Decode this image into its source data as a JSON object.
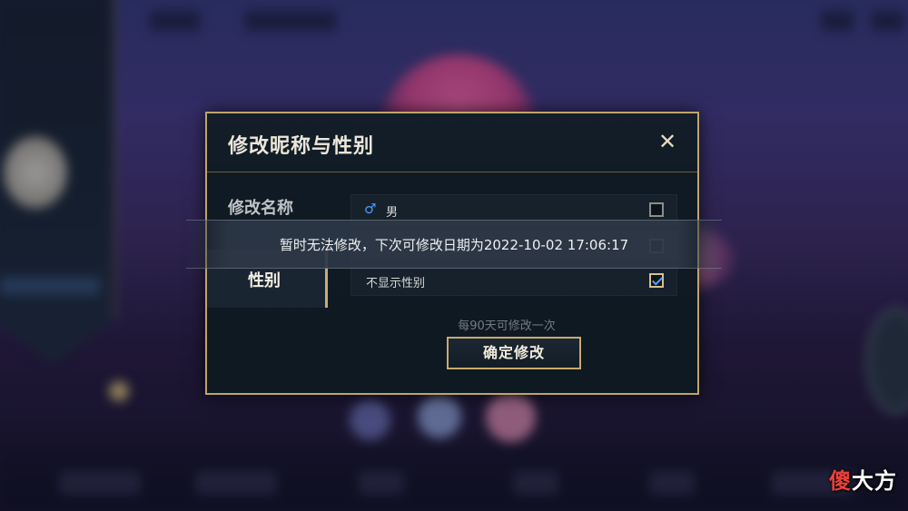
{
  "dialog": {
    "title": "修改昵称与性别",
    "close_icon": "close-icon",
    "tabs": [
      {
        "label": "修改名称"
      },
      {
        "label": "性别"
      }
    ],
    "options": [
      {
        "label": "男",
        "icon": "male-icon",
        "checked": false
      },
      {
        "label": "",
        "checked": false
      },
      {
        "label": "不显示性别",
        "checked": true
      }
    ],
    "hint": "每90天可修改一次",
    "confirm_label": "确定修改"
  },
  "toast": {
    "message": "暂时无法修改，下次可修改日期为2022-10-02 17:06:17"
  },
  "watermark": {
    "first_char": "傻",
    "rest": "大方"
  },
  "colors": {
    "accent_gold": "#bfa46a",
    "checkmark_blue": "#4ea3ff",
    "male_icon_blue": "#4a9cff"
  }
}
